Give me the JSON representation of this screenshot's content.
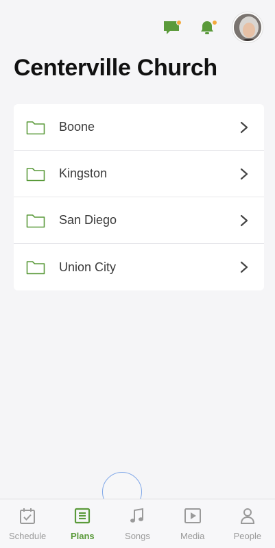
{
  "header": {
    "title": "Centerville Church",
    "icons": [
      "chat-icon",
      "bell-icon",
      "avatar"
    ]
  },
  "folders": [
    {
      "label": "Boone"
    },
    {
      "label": "Kingston"
    },
    {
      "label": "San Diego"
    },
    {
      "label": "Union City"
    }
  ],
  "tabbar": {
    "tabs": [
      {
        "label": "Schedule",
        "icon": "calendar-check-icon",
        "active": false
      },
      {
        "label": "Plans",
        "icon": "plans-icon",
        "active": true
      },
      {
        "label": "Songs",
        "icon": "music-note-icon",
        "active": false
      },
      {
        "label": "Media",
        "icon": "play-icon",
        "active": false
      },
      {
        "label": "People",
        "icon": "person-icon",
        "active": false
      }
    ]
  },
  "colors": {
    "accent": "#5a9a3a",
    "badge": "#f3a93c",
    "tab_inactive": "#9a9a9a"
  }
}
